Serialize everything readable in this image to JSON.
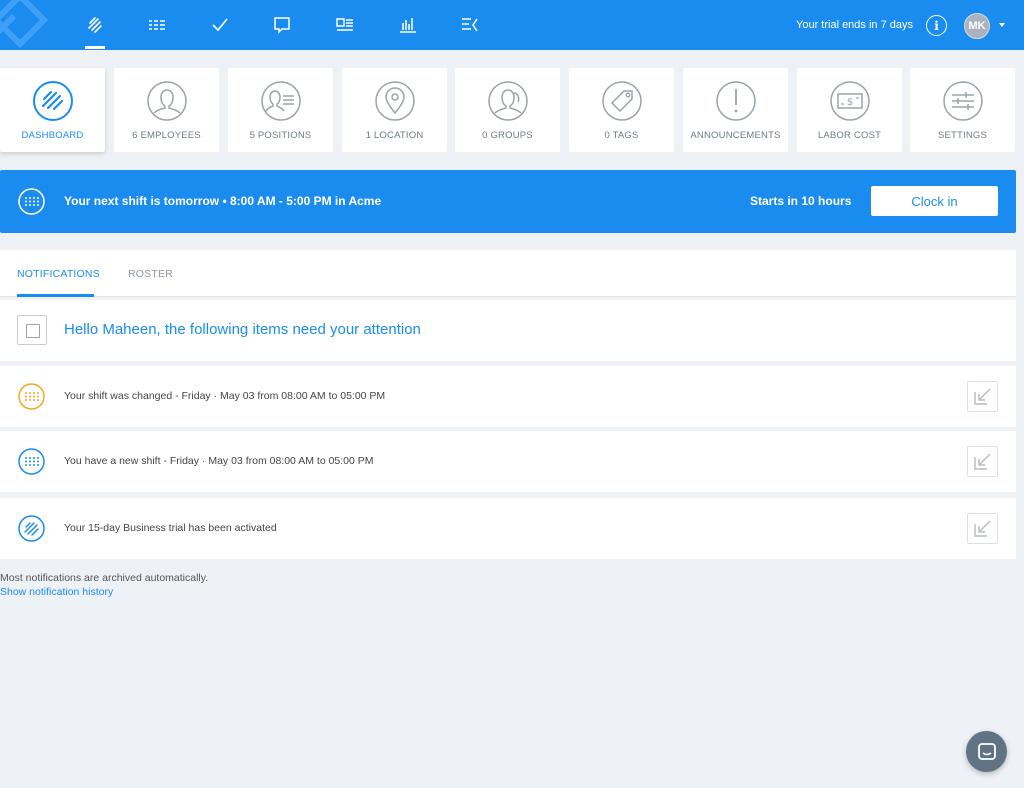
{
  "nav": {
    "items": [
      {
        "icon": "dashboard-icon"
      },
      {
        "icon": "schedule-icon"
      },
      {
        "icon": "tasks-check-icon"
      },
      {
        "icon": "messages-icon"
      },
      {
        "icon": "newsfeed-icon"
      },
      {
        "icon": "reports-icon"
      },
      {
        "icon": "timesheets-icon"
      }
    ],
    "trial_text": "Your trial ends in 7 days",
    "avatar_initials": "MK"
  },
  "tiles": [
    {
      "label": "DASHBOARD",
      "icon": "dashboard-icon",
      "active": true
    },
    {
      "label": "6  EMPLOYEES",
      "icon": "employee-icon"
    },
    {
      "label": "5  POSITIONS",
      "icon": "positions-icon"
    },
    {
      "label": "1  LOCATION",
      "icon": "location-pin-icon"
    },
    {
      "label": "0  GROUPS",
      "icon": "groups-icon"
    },
    {
      "label": "0  TAGS",
      "icon": "tag-icon"
    },
    {
      "label": "ANNOUNCEMENTS",
      "icon": "exclamation-icon"
    },
    {
      "label": "LABOR COST",
      "icon": "money-icon"
    },
    {
      "label": "SETTINGS",
      "icon": "sliders-icon"
    }
  ],
  "banner": {
    "text": "Your next shift is tomorrow • 8:00 AM - 5:00 PM in Acme",
    "starts": "Starts in 10 hours",
    "clock_in": "Clock in"
  },
  "tabs": [
    {
      "label": "NOTIFICATIONS"
    },
    {
      "label": "ROSTER"
    }
  ],
  "attention": "Hello Maheen, the following items need your attention",
  "notifications": [
    {
      "text": "Your shift was changed - Friday · May 03 from 08:00 AM to 05:00 PM",
      "icon": "shift-changed-icon",
      "color": "#f5a623"
    },
    {
      "text": "You have a new shift - Friday · May 03 from 08:00 AM to 05:00 PM",
      "icon": "new-shift-icon",
      "color": "#1a8cf0"
    },
    {
      "text": "Your 15-day Business trial has been activated",
      "icon": "trial-activated-icon",
      "color": "#1a8cf0"
    }
  ],
  "footer": {
    "note": "Most notifications are archived automatically.",
    "link": "Show notification history"
  },
  "colors": {
    "primary": "#1a8cf0",
    "background": "#eef1f5",
    "warning": "#f5a623"
  }
}
